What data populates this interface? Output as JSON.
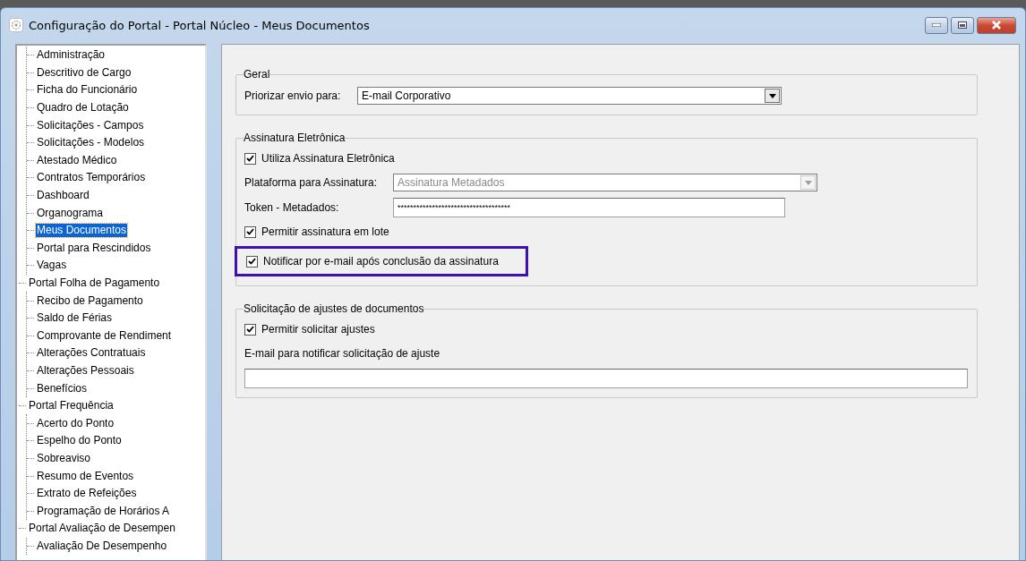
{
  "window": {
    "title": "Configuração do Portal - Portal Núcleo - Meus Documentos"
  },
  "tree": [
    {
      "children": [
        {
          "label": "Administração",
          "selected": false
        },
        {
          "label": "Descritivo de Cargo",
          "selected": false
        },
        {
          "label": "Ficha do Funcionário",
          "selected": false
        },
        {
          "label": "Quadro de Lotação",
          "selected": false
        },
        {
          "label": "Solicitações - Campos",
          "selected": false
        },
        {
          "label": "Solicitações - Modelos",
          "selected": false
        },
        {
          "label": "Atestado Médico",
          "selected": false
        },
        {
          "label": "Contratos Temporários",
          "selected": false
        },
        {
          "label": "Dashboard",
          "selected": false
        },
        {
          "label": "Organograma",
          "selected": false
        },
        {
          "label": "Meus Documentos",
          "selected": true
        },
        {
          "label": "Portal para Rescindidos",
          "selected": false
        },
        {
          "label": "Vagas",
          "selected": false
        }
      ]
    },
    {
      "label": "Portal Folha de Pagamento",
      "selected": false,
      "children": [
        {
          "label": "Recibo de Pagamento",
          "selected": false
        },
        {
          "label": "Saldo de Férias",
          "selected": false
        },
        {
          "label": "Comprovante de Rendiment",
          "selected": false
        },
        {
          "label": "Alterações Contratuais",
          "selected": false
        },
        {
          "label": "Alterações Pessoais",
          "selected": false
        },
        {
          "label": "Benefícios",
          "selected": false
        }
      ]
    },
    {
      "label": "Portal Frequência",
      "selected": false,
      "children": [
        {
          "label": "Acerto do Ponto",
          "selected": false
        },
        {
          "label": "Espelho do Ponto",
          "selected": false
        },
        {
          "label": "Sobreaviso",
          "selected": false
        },
        {
          "label": "Resumo de Eventos",
          "selected": false
        },
        {
          "label": "Extrato de Refeições",
          "selected": false
        },
        {
          "label": "Programação de Horários A",
          "selected": false
        }
      ]
    },
    {
      "label": "Portal Avaliação de Desempen",
      "selected": false,
      "children": [
        {
          "label": "Avaliação De Desempenho",
          "selected": false
        }
      ]
    }
  ],
  "groups": [
    {
      "title": "Geral",
      "fields": [
        {
          "kind": "select",
          "label": "Priorizar envio para:",
          "value": "E-mail Corporativo",
          "disabled": false
        }
      ]
    },
    {
      "title": "Assinatura Eletrônica",
      "fields": [
        {
          "kind": "checkbox",
          "label": "Utiliza Assinatura Eletrônica",
          "checked": true,
          "highlighted": false
        },
        {
          "kind": "select",
          "label": "Plataforma para Assinatura:",
          "value": "Assinatura Metadados",
          "disabled": true
        },
        {
          "kind": "text",
          "label": "Token - Metadados:",
          "value": "************************************"
        },
        {
          "kind": "checkbox",
          "label": "Permitir assinatura em lote",
          "checked": true,
          "highlighted": false
        },
        {
          "kind": "checkbox",
          "label": "Notificar por e-mail após conclusão da assinatura",
          "checked": true,
          "highlighted": true
        }
      ]
    },
    {
      "title": "Solicitação de ajustes de documentos",
      "fields": [
        {
          "kind": "checkbox",
          "label": "Permitir solicitar ajustes",
          "checked": true,
          "highlighted": false
        },
        {
          "kind": "stacked",
          "label": "E-mail para notificar solicitação de ajuste"
        }
      ]
    }
  ]
}
